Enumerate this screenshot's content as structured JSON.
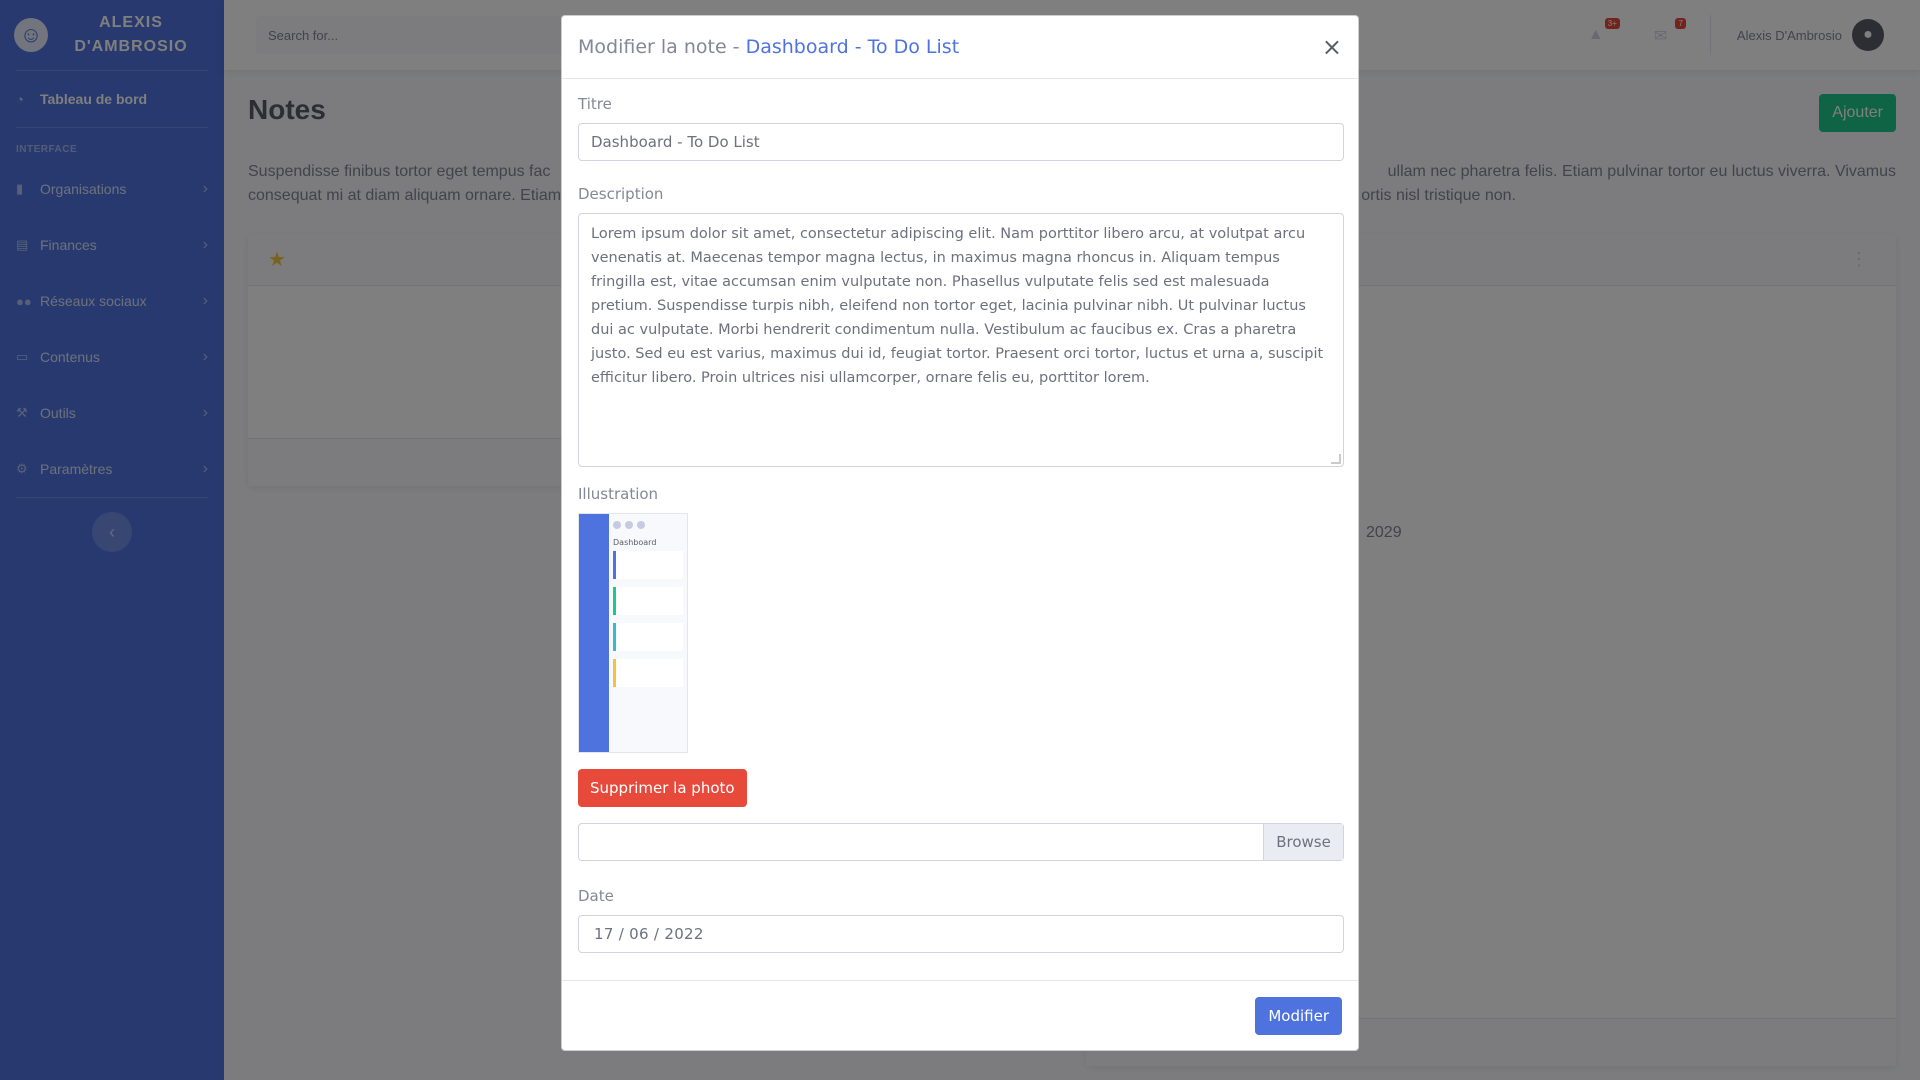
{
  "sidebar": {
    "brand": "ALEXIS D'AMBROSIO",
    "dashboard": "Tableau de bord",
    "heading": "INTERFACE",
    "items": [
      {
        "label": "Organisations"
      },
      {
        "label": "Finances"
      },
      {
        "label": "Réseaux sociaux"
      },
      {
        "label": "Contenus"
      },
      {
        "label": "Outils"
      },
      {
        "label": "Paramètres"
      }
    ]
  },
  "topbar": {
    "search_placeholder": "Search for...",
    "alerts_badge": "3+",
    "messages_badge": "7",
    "user_name": "Alexis D'Ambrosio"
  },
  "page": {
    "title": "Notes",
    "add_label": "Ajouter",
    "description_left": "Suspendisse finibus tortor eget tempus fac",
    "description_left2": "consequat mi at diam aliquam ornare. Etiam",
    "description_right": "ullam nec pharetra felis. Etiam pulvinar tortor eu luctus viverra. Vivamus",
    "description_right2": "ortis nisl tristique non.",
    "card_date_fragment": "2029"
  },
  "modal": {
    "title_prefix": "Modifier la note - ",
    "title_highlight": "Dashboard - To Do List",
    "close": "×",
    "title_label": "Titre",
    "title_value": "Dashboard - To Do List",
    "description_label": "Description",
    "description_value": "Lorem ipsum dolor sit amet, consectetur adipiscing elit. Nam porttitor libero arcu, at volutpat arcu venenatis at. Maecenas tempor magna lectus, in maximus magna rhoncus in. Aliquam tempus fringilla est, vitae accumsan enim vulputate non. Phasellus vulputate felis sed est malesuada pretium. Suspendisse turpis nibh, eleifend non tortor eget, lacinia pulvinar nibh. Ut pulvinar luctus dui ac vulputate. Morbi hendrerit condimentum nulla. Vestibulum ac faucibus ex. Cras a pharetra justo. Sed eu est varius, maximus dui id, feugiat tortor. Praesent orci tortor, luctus et urna a, suscipit efficitur libero. Proin ultrices nisi ullamcorper, ornare felis eu, porttitor lorem.",
    "illustration_label": "Illustration",
    "thumbnail_title": "Dashboard",
    "delete_photo": "Supprimer la photo",
    "browse": "Browse",
    "date_label": "Date",
    "date_value": "17 / 06 / 2022",
    "submit": "Modifier"
  },
  "colors": {
    "primary": "#4e73df",
    "success": "#1cc88a",
    "danger": "#e74a3b",
    "warning": "#f6c23e"
  },
  "icons": {
    "brand": "smile-wink-icon",
    "dashboard": "tachometer-icon",
    "organisations": "building-icon",
    "finances": "money-icon",
    "social": "users-icon",
    "content": "desktop-icon",
    "tools": "wrench-icon",
    "settings": "cog-icon",
    "star": "star-icon"
  }
}
